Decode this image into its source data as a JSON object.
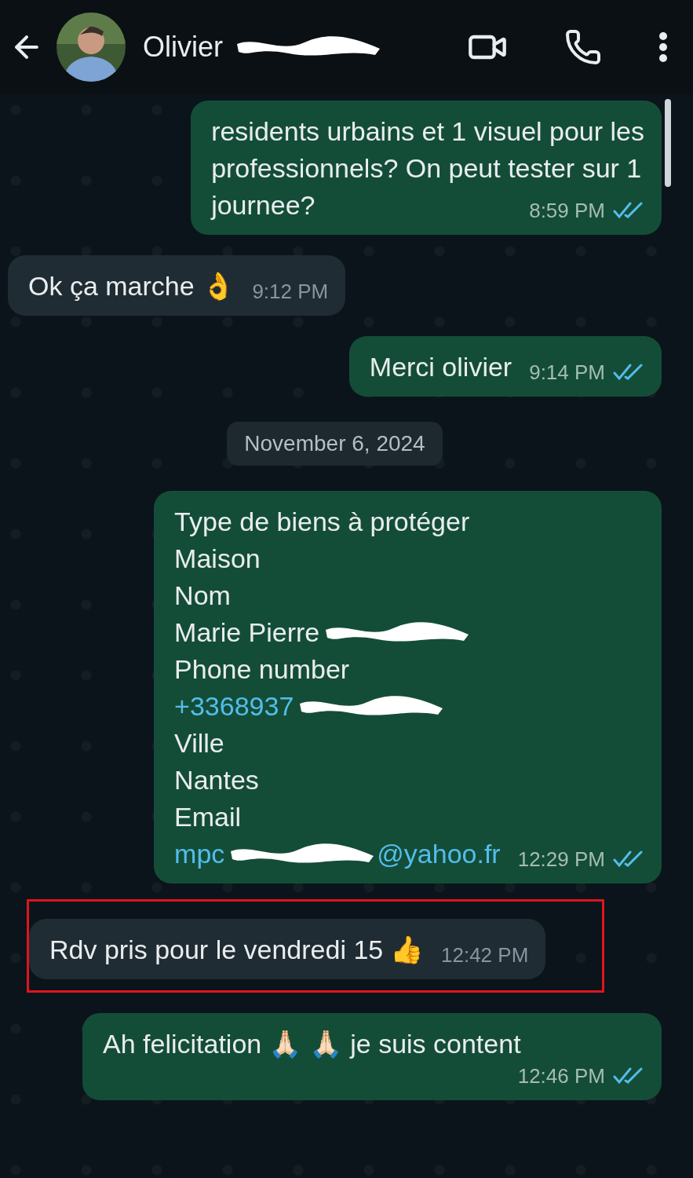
{
  "header": {
    "name": "Olivier",
    "name_redacted": true
  },
  "messages": [
    {
      "kind": "out",
      "time": "8:59 PM",
      "read": true,
      "highlighted": false,
      "lines": [
        [
          {
            "kind": "text",
            "text": "residents urbains et 1 visuel pour les"
          }
        ],
        [
          {
            "kind": "text",
            "text": "professionnels? On peut tester sur 1"
          }
        ],
        [
          {
            "kind": "text",
            "text": "journee?"
          }
        ]
      ]
    },
    {
      "kind": "in",
      "time": "9:12 PM",
      "highlighted": false,
      "lines": [
        [
          {
            "kind": "text",
            "text": "Ok ça marche 👌"
          }
        ]
      ]
    },
    {
      "kind": "out",
      "time": "9:14 PM",
      "read": true,
      "highlighted": false,
      "lines": [
        [
          {
            "kind": "text",
            "text": "Merci olivier"
          }
        ]
      ]
    },
    {
      "kind": "date",
      "text": "November 6, 2024"
    },
    {
      "kind": "out",
      "time": "12:29 PM",
      "read": true,
      "highlighted": false,
      "lines": [
        [
          {
            "kind": "text",
            "text": "Type de biens à protéger"
          }
        ],
        [
          {
            "kind": "text",
            "text": "Maison"
          }
        ],
        [
          {
            "kind": "text",
            "text": "Nom"
          }
        ],
        [
          {
            "kind": "text",
            "text": "Marie Pierre"
          },
          {
            "kind": "redaction"
          }
        ],
        [
          {
            "kind": "text",
            "text": "Phone number"
          }
        ],
        [
          {
            "kind": "link",
            "text": "+3368937"
          },
          {
            "kind": "redaction"
          }
        ],
        [
          {
            "kind": "text",
            "text": "Ville"
          }
        ],
        [
          {
            "kind": "text",
            "text": "Nantes"
          }
        ],
        [
          {
            "kind": "text",
            "text": "Email"
          }
        ],
        [
          {
            "kind": "link",
            "text": "mpc"
          },
          {
            "kind": "redaction"
          },
          {
            "kind": "link",
            "text": "@yahoo.fr"
          }
        ]
      ]
    },
    {
      "kind": "in",
      "time": "12:42 PM",
      "highlighted": true,
      "lines": [
        [
          {
            "kind": "text",
            "text": "Rdv pris pour le vendredi 15 👍"
          }
        ]
      ]
    },
    {
      "kind": "out",
      "time": "12:46 PM",
      "read": true,
      "highlighted": false,
      "lines": [
        [
          {
            "kind": "text",
            "text": "Ah felicitation 🙏🏻 🙏🏻 je suis content"
          }
        ]
      ]
    }
  ]
}
